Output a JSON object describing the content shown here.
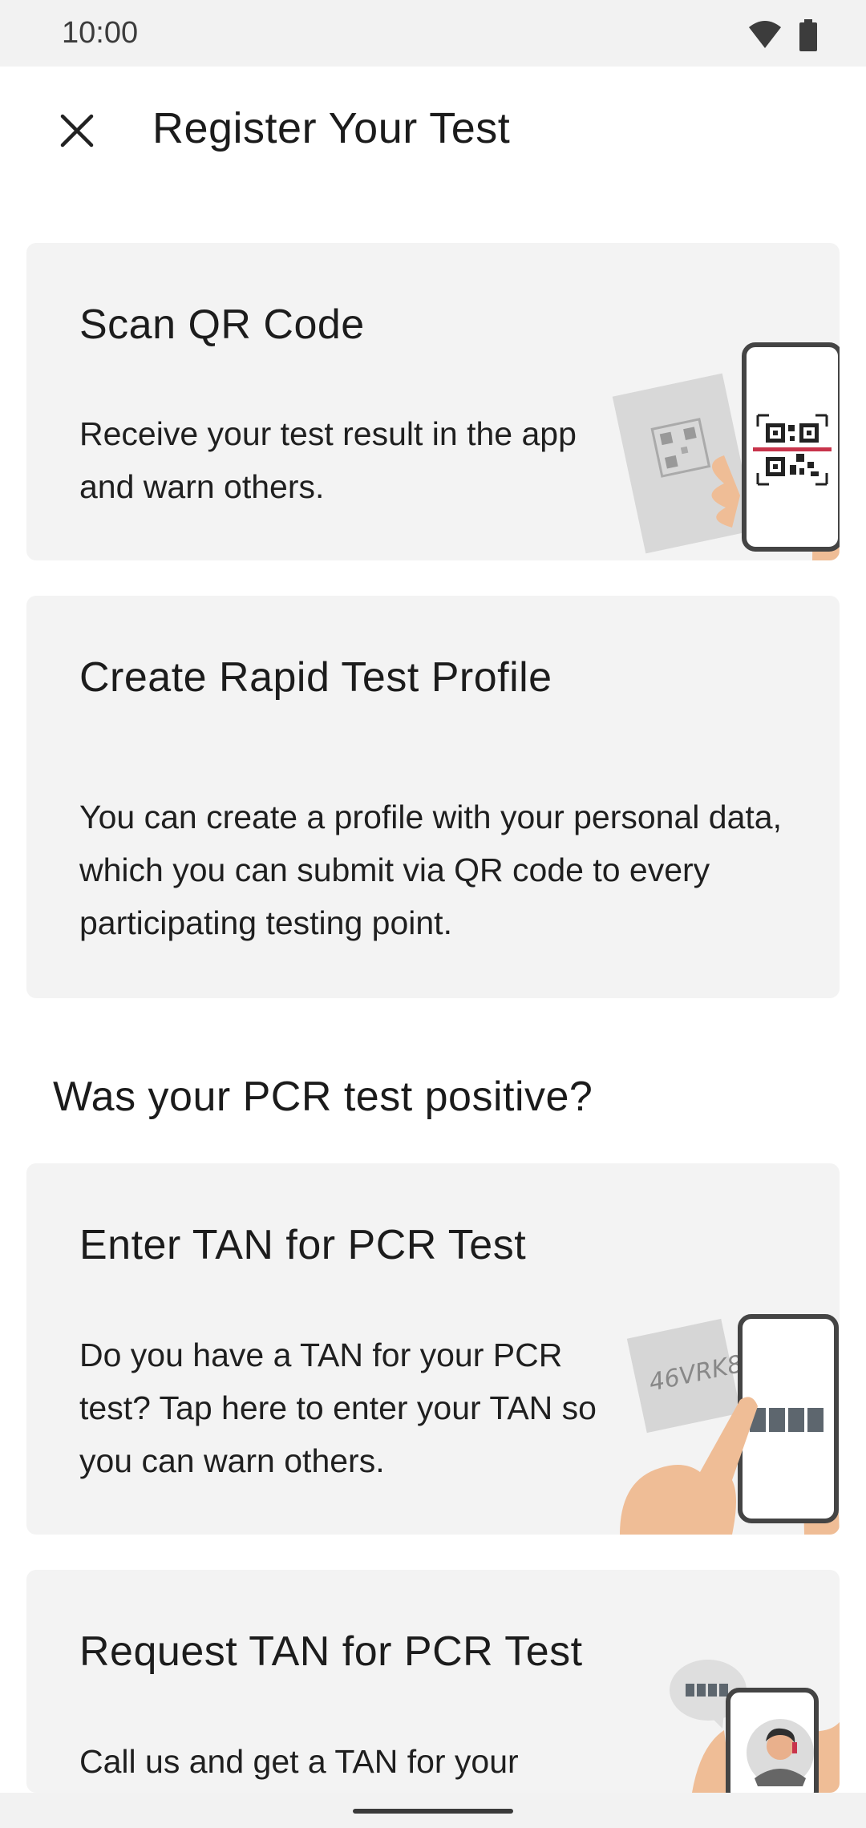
{
  "status_bar": {
    "time": "10:00",
    "icons": [
      "wifi-icon",
      "battery-icon"
    ]
  },
  "app_bar": {
    "title": "Register Your Test",
    "close_icon": "close-icon"
  },
  "cards": [
    {
      "title": "Scan QR Code",
      "body": "Receive your test result in the app and warn others.",
      "illustration": "qr-scan-illustration"
    },
    {
      "title": "Create Rapid Test Profile",
      "body": "You can create a profile with your personal data, which you can submit via QR code to every participating testing point."
    }
  ],
  "section": {
    "header": "Was your PCR test positive?"
  },
  "pcr_cards": [
    {
      "title": "Enter TAN for PCR Test",
      "body": "Do you have a TAN for your PCR test? Tap here to enter your TAN so you can warn others.",
      "illustration": "tan-entry-illustration",
      "tan_text": "46VRK8"
    },
    {
      "title": "Request TAN for PCR Test",
      "body": "Call us and get a TAN for your",
      "illustration": "hotline-illustration"
    }
  ],
  "colors": {
    "card_bg": "#f3f3f3",
    "skin": "#efbd96",
    "phone_frame": "#444444",
    "scan_line": "#c8344b"
  }
}
